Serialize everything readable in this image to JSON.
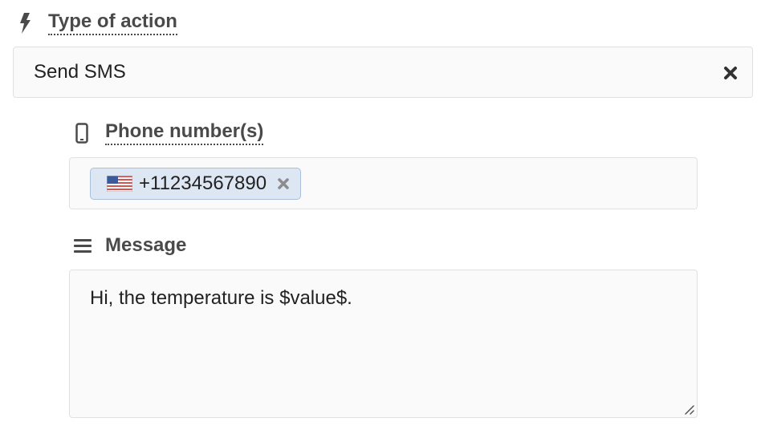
{
  "action": {
    "label": "Type of action",
    "selected_value": "Send SMS",
    "icon": "lightning-icon",
    "clear_icon": "close-icon"
  },
  "phone": {
    "label": "Phone number(s)",
    "icon": "mobile-phone-icon",
    "tags": [
      {
        "flag": "us-flag-icon",
        "value": "+11234567890",
        "remove_icon": "close-icon"
      }
    ]
  },
  "message": {
    "label": "Message",
    "icon": "hamburger-lines-icon",
    "value": "Hi, the temperature is $value$."
  },
  "colors": {
    "label_text": "#4a4a4a",
    "field_bg": "#fafafa",
    "field_border": "#e1e1e1",
    "tag_bg": "#dde7f3",
    "tag_border": "#a9c0da",
    "icon_gray": "#8c8c8c"
  }
}
